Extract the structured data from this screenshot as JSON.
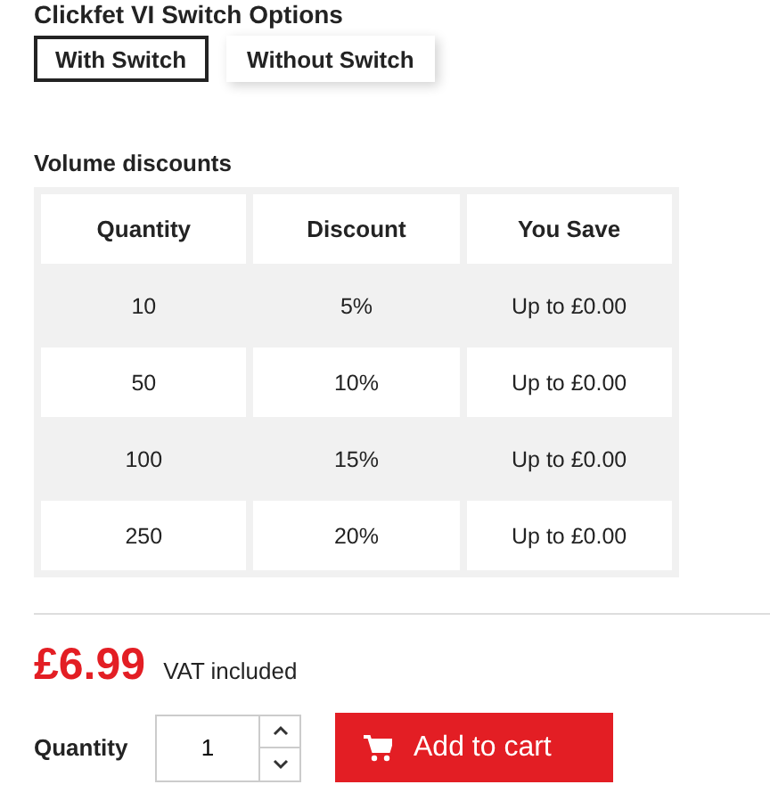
{
  "options": {
    "title": "Clickfet VI Switch Options",
    "choices": [
      {
        "label": "With Switch",
        "selected": true
      },
      {
        "label": "Without Switch",
        "selected": false
      }
    ]
  },
  "volume_discounts": {
    "title": "Volume discounts",
    "columns": [
      "Quantity",
      "Discount",
      "You Save"
    ],
    "rows": [
      [
        "10",
        "5%",
        "Up to £0.00"
      ],
      [
        "50",
        "10%",
        "Up to £0.00"
      ],
      [
        "100",
        "15%",
        "Up to £0.00"
      ],
      [
        "250",
        "20%",
        "Up to £0.00"
      ]
    ]
  },
  "price": {
    "amount": "£6.99",
    "tax_note": "VAT included"
  },
  "quantity": {
    "label": "Quantity",
    "value": "1"
  },
  "add_to_cart": {
    "label": "Add to cart"
  }
}
